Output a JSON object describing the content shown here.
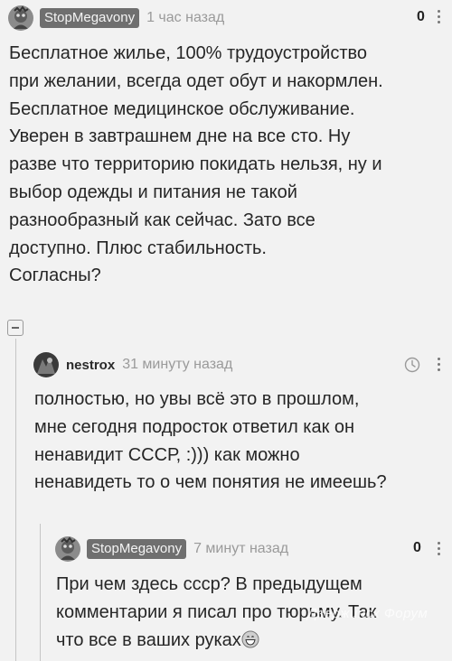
{
  "comments": [
    {
      "author": "StopMegavony",
      "time": "1 час назад",
      "rating": "0",
      "text": "Бесплатное жилье, 100% трудоустройство\nпри желании, всегда одет обут и накормлен.\nБесплатное медицинское обслуживание.\nУверен в завтрашнем дне на все сто. Ну\nразве что территорию покидать нельзя, ну и\nвыбор одежды и питания не такой\nразнообразный как сейчас. Зато все\nдоступно. Плюс стабильность.\nСогласны?"
    },
    {
      "author": "nestrox",
      "time": "31 минуту назад",
      "text": "полностью, но увы всё это в прошлом,\nмне сегодня подросток ответил как он\nненавидит СССР, :))) как можно\nненавидеть то о чем понятия не имеешь?"
    },
    {
      "author": "StopMegavony",
      "time": "7 минут назад",
      "rating": "0",
      "text": "При чем здесь ссср? В предыдущем\nкомментарии я писал про тюрьму. Так\nчто все в ваших руках"
    }
  ],
  "watermark": "Дзержинск Форум",
  "icons": {
    "collapse": "minus-square-icon",
    "clock": "clock-icon",
    "menu": "vertical-dots-icon",
    "emoji": "grinning-face-icon"
  },
  "colors": {
    "background": "#f2f2f2",
    "author_badge": "#6f6f6f",
    "muted_text": "#9a9a9a"
  }
}
